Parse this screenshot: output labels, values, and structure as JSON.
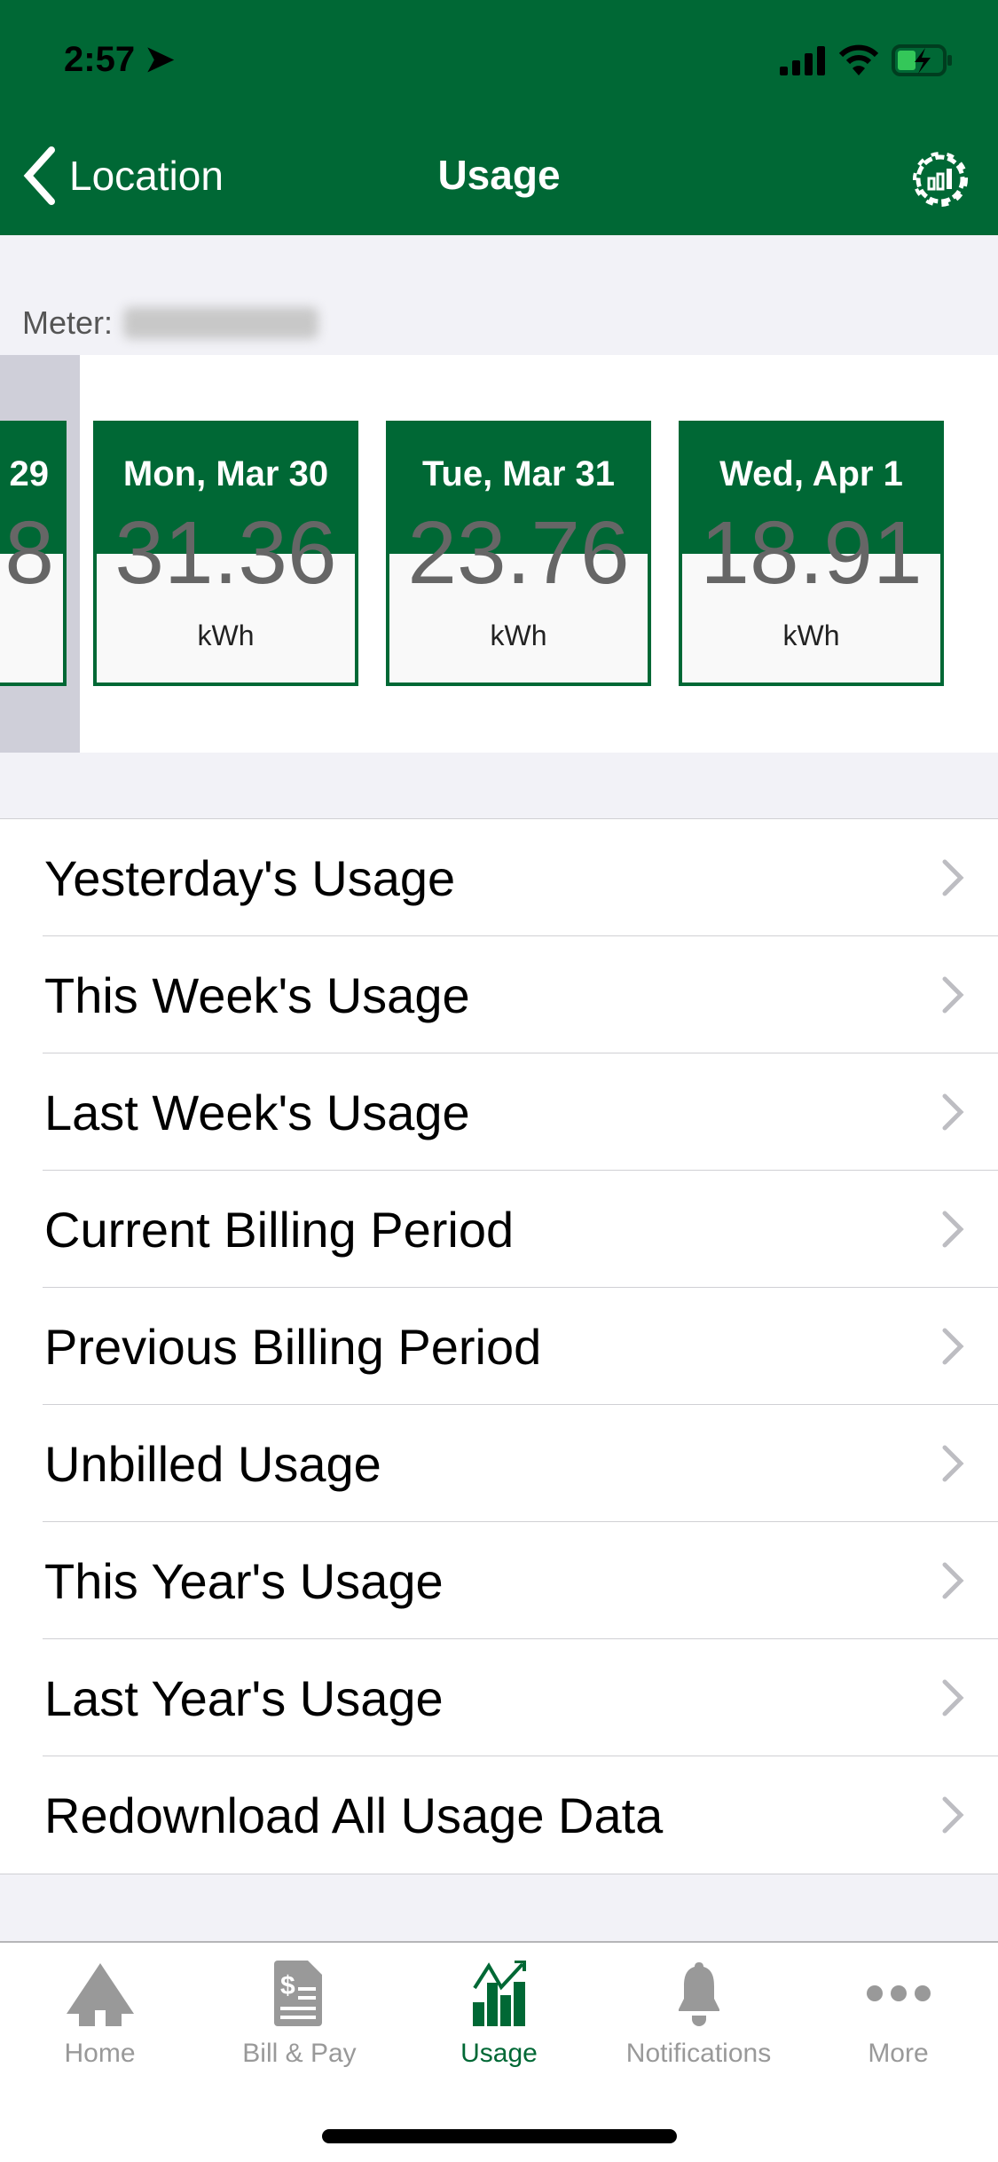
{
  "status": {
    "time": "2:57"
  },
  "nav": {
    "back_label": "Location",
    "title": "Usage"
  },
  "meter_label": "Meter:",
  "cards": [
    {
      "date": "29",
      "value": "8",
      "unit": ""
    },
    {
      "date": "Mon, Mar 30",
      "value": "31.36",
      "unit": "kWh"
    },
    {
      "date": "Tue, Mar 31",
      "value": "23.76",
      "unit": "kWh"
    },
    {
      "date": "Wed, Apr 1",
      "value": "18.91",
      "unit": "kWh"
    }
  ],
  "menu": [
    "Yesterday's Usage",
    "This Week's Usage",
    "Last Week's Usage",
    "Current Billing Period",
    "Previous Billing Period",
    "Unbilled Usage",
    "This Year's Usage",
    "Last Year's Usage",
    "Redownload All Usage Data"
  ],
  "tabs": [
    {
      "label": "Home",
      "icon": "home-icon"
    },
    {
      "label": "Bill & Pay",
      "icon": "bill-icon"
    },
    {
      "label": "Usage",
      "icon": "usage-chart-icon",
      "active": true
    },
    {
      "label": "Notifications",
      "icon": "bell-icon"
    },
    {
      "label": "More",
      "icon": "more-icon"
    }
  ],
  "colors": {
    "brand": "#006835",
    "inactive": "#999999"
  }
}
